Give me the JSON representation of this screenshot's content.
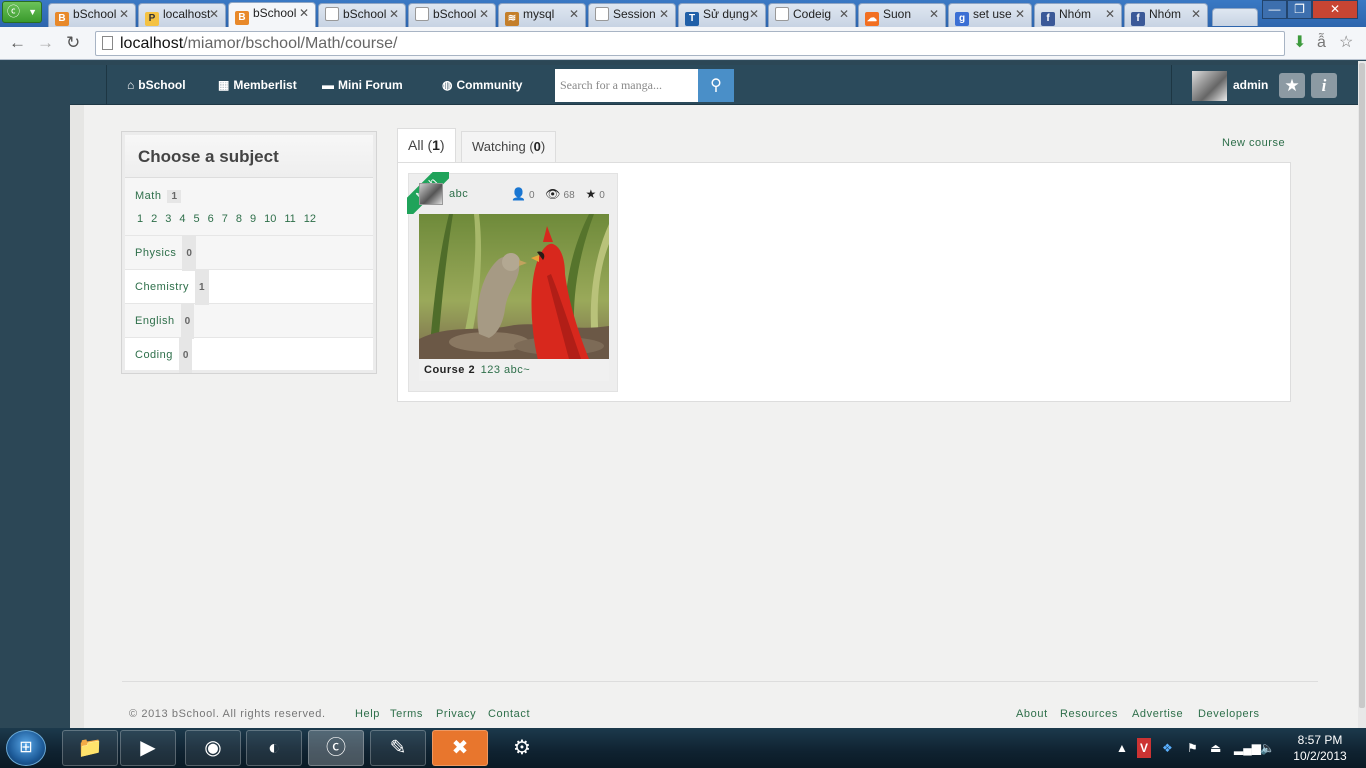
{
  "browser": {
    "tabs": [
      {
        "label": "bSchool",
        "favicon": "bschool-icon",
        "active": false
      },
      {
        "label": "localhost",
        "favicon": "pma-icon",
        "active": false
      },
      {
        "label": "bSchool",
        "favicon": "bschool-icon",
        "active": true
      },
      {
        "label": "bSchool",
        "favicon": "page-icon",
        "active": false
      },
      {
        "label": "bSchool",
        "favicon": "page-icon",
        "active": false
      },
      {
        "label": "mysql",
        "favicon": "mysql-icon",
        "active": false
      },
      {
        "label": "Session",
        "favicon": "page-icon",
        "active": false
      },
      {
        "label": "Sử dụng",
        "favicon": "t-icon",
        "active": false
      },
      {
        "label": "Codeig",
        "favicon": "page-icon",
        "active": false
      },
      {
        "label": "Suon",
        "favicon": "soundcloud-icon",
        "active": false
      },
      {
        "label": "set use",
        "favicon": "google-icon",
        "active": false
      },
      {
        "label": "Nhóm",
        "favicon": "facebook-icon",
        "active": false
      },
      {
        "label": "Nhóm",
        "favicon": "facebook-icon",
        "active": false
      }
    ],
    "url_host": "localhost",
    "url_path": "/miamor/bschool/Math/course/"
  },
  "navbar": {
    "brand": "bSchool",
    "memberlist": "Memberlist",
    "mini_forum": "Mini Forum",
    "community": "Community",
    "search_placeholder": "Search for a manga...",
    "username": "admin"
  },
  "sidebar": {
    "title": "Choose a subject",
    "subjects": [
      {
        "name": "Math",
        "count": "1"
      },
      {
        "name": "Physics",
        "count": "0"
      },
      {
        "name": "Chemistry",
        "count": "1"
      },
      {
        "name": "English",
        "count": "0"
      },
      {
        "name": "Coding",
        "count": "0"
      }
    ],
    "grades": [
      "1",
      "2",
      "3",
      "4",
      "5",
      "6",
      "7",
      "8",
      "9",
      "10",
      "11",
      "12"
    ]
  },
  "main": {
    "tab_all_label": "All",
    "tab_all_count": "1",
    "tab_watching_label": "Watching",
    "tab_watching_count": "0",
    "new_course": "New course",
    "course": {
      "subject_tag": "Math",
      "author": "abc",
      "students": "0",
      "views": "68",
      "stars": "0",
      "title": "Course 2",
      "description": "123 abc~"
    }
  },
  "footer": {
    "copyright": "© 2013 bSchool. All rights reserved.",
    "links_left": [
      "Help",
      "Terms",
      "Privacy",
      "Contact"
    ],
    "links_right": [
      "About",
      "Resources",
      "Advertise",
      "Developers"
    ]
  },
  "taskbar": {
    "time": "8:57 PM",
    "date": "10/2/2013"
  },
  "colors": {
    "link_green": "#2e6f4a",
    "navbar_bg": "#2b4a5b",
    "search_button": "#4a8fc8",
    "ribbon_green": "#1fa35a"
  }
}
